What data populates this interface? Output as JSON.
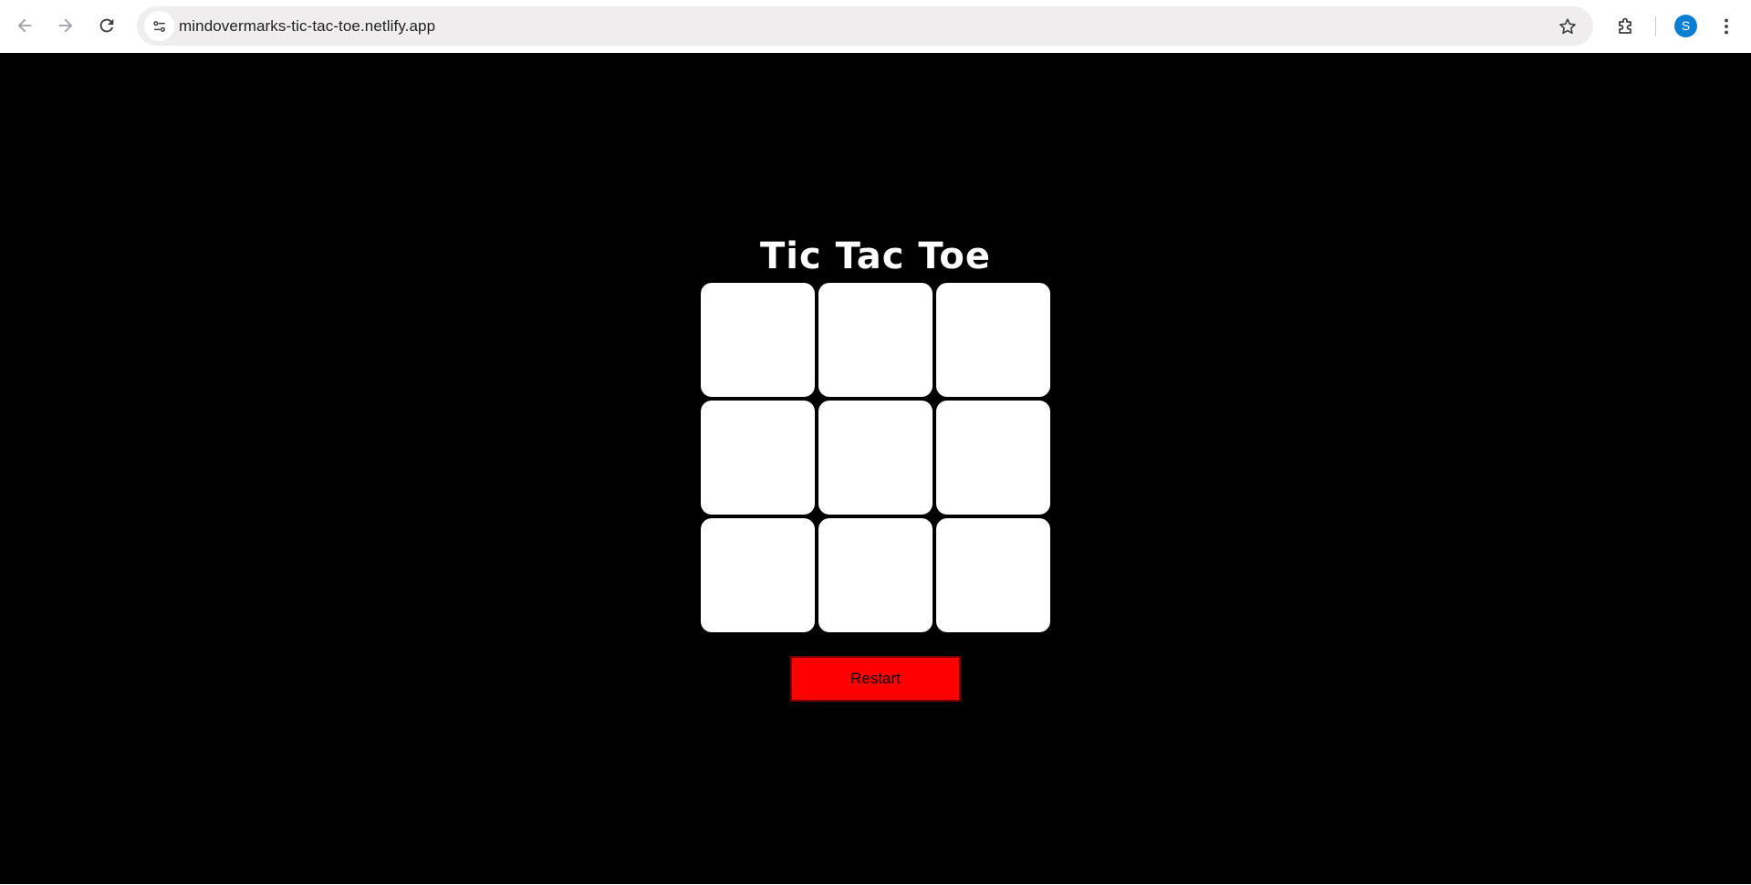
{
  "browser": {
    "url": "mindovermarks-tic-tac-toe.netlify.app",
    "profile_initial": "S",
    "icons": {
      "back": "back-arrow-icon",
      "forward": "forward-arrow-icon",
      "reload": "reload-icon",
      "site_info": "site-settings-icon",
      "bookmark": "star-icon",
      "extensions": "puzzle-piece-icon",
      "menu": "kebab-menu-icon"
    },
    "colors": {
      "avatar": "#0b7fd4",
      "omnibox": "#efeded"
    }
  },
  "game": {
    "title": "Tic Tac Toe",
    "cells": [
      "",
      "",
      "",
      "",
      "",
      "",
      "",
      "",
      ""
    ],
    "restart_label": "Restart",
    "colors": {
      "background": "#000000",
      "cell": "#ffffff",
      "restart": "#ff0000"
    }
  }
}
